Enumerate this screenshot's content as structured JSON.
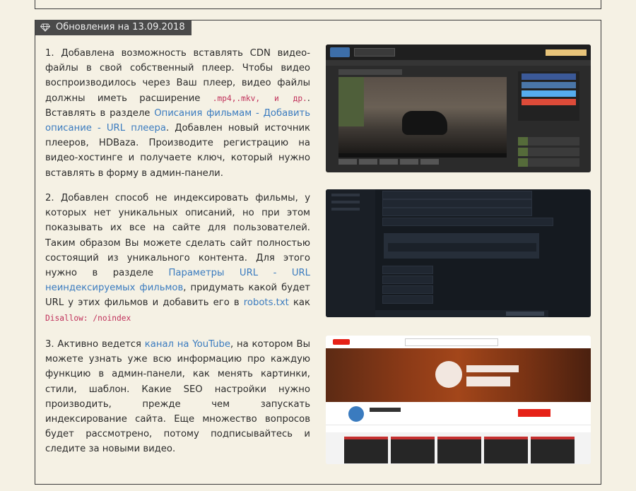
{
  "section": {
    "badge_icon": "diamond-icon",
    "title": "Обновления на 13.09.2018"
  },
  "items": [
    {
      "p1": "1. Добавлена возможность вставлять CDN видео-файлы в свой собственный плеер. Чтобы видео воспроизводилось через Ваш плеер, видео файлы должны иметь расширение ",
      "code1": ".mp4,.mkv, и др.",
      "p2": ". Вставлять в разделе ",
      "link1": "Описания фильмам - Добавить описание - URL плеера",
      "p3": ". Добавлен новый источник плееров, HDBaza. Производите регистрацию на видео-хостинге и получаете ключ, который нужно вставлять в форму в админ-панели."
    },
    {
      "p1": "2. Добавлен способ не индексировать фильмы, у которых нет уникальных описаний, но при этом показывать их все на сайте для пользователей. Таким образом Вы можете сделать сайт полностью состоящий из уникального контента. Для этого нужно в разделе ",
      "link1": "Параметры URL - URL неиндексируемых фильмов",
      "p2": ", придумать какой будет URL у этих фильмов и добавить его в ",
      "link2": "robots.txt",
      "p3": " как ",
      "code1": "Disallow: /noindex"
    },
    {
      "p1": "3. Активно ведется ",
      "link1": "канал на YouTube",
      "p2": ", на котором Вы можете узнать уже всю информацию про каждую функцию в админ-панели, как менять картинки, стили, шаблон. Какие SEO настройки нужно производить, прежде чем запускать индексирование сайта. Еще множество вопросов будет рассмотрено, потому подписывайтесь и следите за новыми видео."
    }
  ],
  "colors": {
    "background": "#f5f1e4",
    "badge": "#4a4a4a",
    "link": "#3a7bbf",
    "code": "#c0305a"
  }
}
